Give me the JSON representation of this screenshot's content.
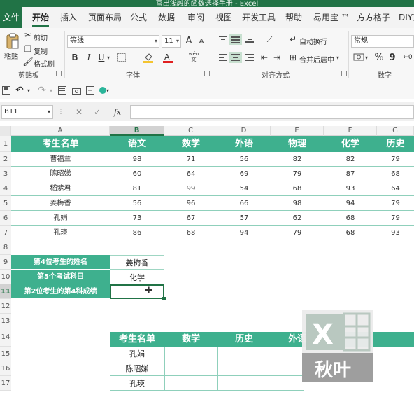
{
  "window": {
    "title": "富出浅融的函数选择手册 - Excel"
  },
  "menu": {
    "tabs": [
      "文件",
      "开始",
      "插入",
      "页面布局",
      "公式",
      "数据",
      "审阅",
      "视图",
      "开发工具",
      "帮助",
      "易用宝 ™",
      "方方格子",
      "DIY工"
    ],
    "active": "开始"
  },
  "ribbon": {
    "clipboard": {
      "paste": "粘贴",
      "cut": "剪切",
      "copy": "复制",
      "format_painter": "格式刷",
      "label": "剪贴板"
    },
    "font": {
      "name": "等线",
      "size": "11",
      "bold": "B",
      "italic": "I",
      "underline": "U",
      "label": "字体",
      "grow": "A",
      "shrink": "A",
      "phonetic": "wén"
    },
    "alignment": {
      "wrap": "自动换行",
      "merge": "合并后居中",
      "label": "对齐方式"
    },
    "number": {
      "format": "常规",
      "percent": "%",
      "comma": "9",
      "label": "数字"
    }
  },
  "formula_bar": {
    "name_box": "B11",
    "fx": "fx",
    "content": ""
  },
  "sheet": {
    "columns": [
      "A",
      "B",
      "C",
      "D",
      "E",
      "F",
      "G"
    ],
    "selected_column": "B",
    "rows": [
      "1",
      "2",
      "3",
      "4",
      "5",
      "6",
      "7",
      "8",
      "9",
      "10",
      "11",
      "12",
      "13",
      "14",
      "15",
      "16",
      "17"
    ],
    "selected_row": "11",
    "score_table": {
      "headers": [
        "考生名单",
        "语文",
        "数学",
        "外语",
        "物理",
        "化学",
        "历史"
      ],
      "rows": [
        [
          "曹福兰",
          "98",
          "71",
          "56",
          "82",
          "82",
          "79"
        ],
        [
          "陈昭娣",
          "60",
          "64",
          "69",
          "79",
          "87",
          "68"
        ],
        [
          "嵇紫君",
          "81",
          "99",
          "54",
          "68",
          "93",
          "64"
        ],
        [
          "姜梅香",
          "56",
          "96",
          "66",
          "98",
          "94",
          "79"
        ],
        [
          "孔娟",
          "73",
          "67",
          "57",
          "62",
          "68",
          "79"
        ],
        [
          "孔瑛",
          "86",
          "68",
          "94",
          "79",
          "68",
          "93"
        ]
      ]
    },
    "query": [
      {
        "label": "第4位考生的姓名",
        "value": "姜梅香"
      },
      {
        "label": "第5个考试科目",
        "value": "化学"
      },
      {
        "label": "第2位考生的第4科成绩",
        "value": ""
      }
    ],
    "lookup_table": {
      "headers": [
        "考生名单",
        "数学",
        "历史",
        "外语"
      ],
      "names": [
        "孔娟",
        "陈昭娣",
        "孔瑛"
      ]
    }
  },
  "watermark": {
    "text": "秋叶",
    "letter": "X"
  },
  "colors": {
    "excel_green": "#217346",
    "table_green": "#3eb08e"
  }
}
